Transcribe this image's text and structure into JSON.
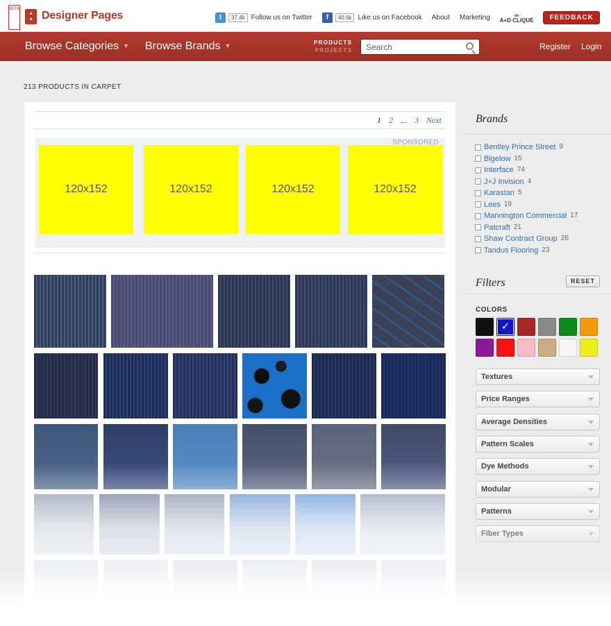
{
  "brand": {
    "beta": "BETA",
    "name": "Designer Pages"
  },
  "topbar": {
    "twitter_count": "37.4k",
    "twitter_label": "Follow us on Twitter",
    "facebook_count": "40.6k",
    "facebook_label": "Like us on Facebook",
    "about": "About",
    "marketing": "Marketing",
    "clique_glyph": "∞",
    "clique_label": "A+D CLIQUE",
    "feedback": "FEEDBACK"
  },
  "nav": {
    "browse_categories": "Browse Categories",
    "browse_brands": "Browse Brands",
    "products": "PRODUCTS",
    "projects": "PROJECTS",
    "search_placeholder": "Search",
    "register": "Register",
    "login": "Login"
  },
  "listing": {
    "count_title": "213 PRODUCTS IN CARPET"
  },
  "pagination": {
    "pages": [
      "1",
      "2",
      "...",
      "3"
    ],
    "next": "Next"
  },
  "sponsored": {
    "label": "SPONSORED",
    "ads": [
      "120x152",
      "120x152",
      "120x152",
      "120x152"
    ]
  },
  "sidebar": {
    "brands_title": "Brands",
    "brands": [
      {
        "name": "Bentley Prince Street",
        "count": "9"
      },
      {
        "name": "Bigelow",
        "count": "15"
      },
      {
        "name": "Interface",
        "count": "74"
      },
      {
        "name": "J+J Invision",
        "count": "4"
      },
      {
        "name": "Karastan",
        "count": "5"
      },
      {
        "name": "Lees",
        "count": "19"
      },
      {
        "name": "Mannington Commercial",
        "count": "17"
      },
      {
        "name": "Patcraft",
        "count": "21"
      },
      {
        "name": "Shaw Contract Group",
        "count": "26"
      },
      {
        "name": "Tandus Flooring",
        "count": "23"
      }
    ],
    "filters_title": "Filters",
    "reset": "RESET",
    "colors_label": "COLORS",
    "colors": [
      {
        "name": "black",
        "hex": "#111111"
      },
      {
        "name": "blue",
        "hex": "#1515c8",
        "selected": true
      },
      {
        "name": "dark-red",
        "hex": "#a2282a"
      },
      {
        "name": "gray",
        "hex": "#8a8a8a"
      },
      {
        "name": "green",
        "hex": "#0f8a1a"
      },
      {
        "name": "orange",
        "hex": "#f29a0a"
      },
      {
        "name": "purple",
        "hex": "#8a1a98"
      },
      {
        "name": "red",
        "hex": "#f21414"
      },
      {
        "name": "pink",
        "hex": "#f6bcc6"
      },
      {
        "name": "tan",
        "hex": "#c9ac82"
      },
      {
        "name": "white",
        "hex": "#f7f7f7"
      },
      {
        "name": "yellow",
        "hex": "#eeee1a"
      }
    ],
    "dropdowns": [
      "Textures",
      "Price Ranges",
      "Average Densities",
      "Pattern Scales",
      "Dye Methods",
      "Modular",
      "Patterns",
      "Fiber Types"
    ]
  },
  "products": [
    {
      "name": "carpet-tile-1",
      "color": "#2f3d5a",
      "color2": "#4a5f7e"
    },
    {
      "name": "carpet-tile-2",
      "color": "#4a4a72",
      "color2": "#5c5b86"
    },
    {
      "name": "carpet-tile-3",
      "color": "#2a3650",
      "color2": "#3e4c6a"
    },
    {
      "name": "carpet-tile-4",
      "color": "#2c3855",
      "color2": "#3e4d6c"
    },
    {
      "name": "carpet-tile-5",
      "color": "#3b4256",
      "color2": "#2b5a9c"
    },
    {
      "name": "carpet-tile-6",
      "color": "#232b45",
      "color2": "#31395a"
    },
    {
      "name": "carpet-tile-7",
      "color": "#1c2c52",
      "color2": "#2e4478"
    },
    {
      "name": "carpet-tile-8",
      "color": "#232f56",
      "color2": "#34447a"
    },
    {
      "name": "carpet-tile-9",
      "color": "#1c6fc6",
      "color2": "#0e0e0e"
    },
    {
      "name": "carpet-tile-10",
      "color": "#1c2a4e",
      "color2": "#2a3a66"
    },
    {
      "name": "carpet-tile-11",
      "color": "#1a2a56",
      "color2": "#223470"
    },
    {
      "name": "carpet-tile-12",
      "color": "#3e5678",
      "color2": "#4f688c"
    },
    {
      "name": "carpet-tile-13",
      "color": "#2e3e66",
      "color2": "#3e5186"
    },
    {
      "name": "carpet-tile-14",
      "color": "#4a7fb8",
      "color2": "#5b8fc6"
    },
    {
      "name": "carpet-tile-15",
      "color": "#45506a",
      "color2": "#5a6480"
    },
    {
      "name": "carpet-tile-16",
      "color": "#5a6478",
      "color2": "#6c7488"
    },
    {
      "name": "carpet-tile-17",
      "color": "#3e4a66",
      "color2": "#54608a"
    },
    {
      "name": "carpet-tile-18",
      "color": "#8a94a6",
      "color2": "#aab4c4"
    },
    {
      "name": "carpet-tile-19",
      "color": "#6a7294",
      "color2": "#8d94b0"
    },
    {
      "name": "carpet-tile-20",
      "color": "#7c8aa8",
      "color2": "#9aa8c2"
    },
    {
      "name": "carpet-tile-21",
      "color": "#5e8cc2",
      "color2": "#86aed6"
    },
    {
      "name": "carpet-tile-22",
      "color": "#5a8ed0",
      "color2": "#86b2e0"
    },
    {
      "name": "carpet-tile-23",
      "color": "#8a9ab2",
      "color2": "#b6c2d2"
    },
    {
      "name": "carpet-tile-24",
      "color": "#8894a8",
      "color2": "#a8b2c2"
    },
    {
      "name": "carpet-tile-25",
      "color": "#9aa2b6",
      "color2": "#b6bccc"
    },
    {
      "name": "carpet-tile-26",
      "color": "#6e7e9a",
      "color2": "#8a98b0"
    },
    {
      "name": "carpet-tile-27",
      "color": "#8894ac",
      "color2": "#a4aec2"
    },
    {
      "name": "carpet-tile-28",
      "color": "#7e8aa4",
      "color2": "#98a2b8"
    },
    {
      "name": "carpet-tile-29",
      "color": "#8a98b4",
      "color2": "#a6b2c8"
    }
  ]
}
